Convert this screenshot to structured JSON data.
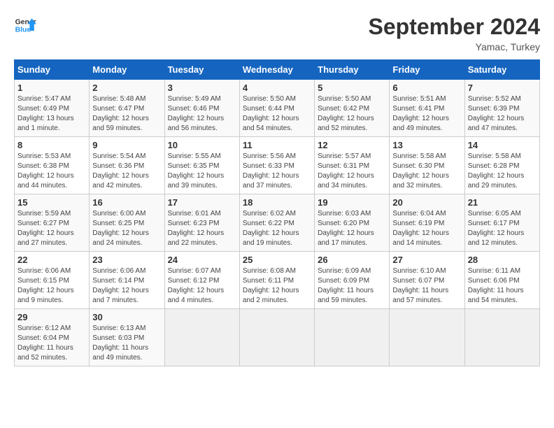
{
  "header": {
    "logo_line1": "General",
    "logo_line2": "Blue",
    "month": "September 2024",
    "location": "Yamac, Turkey"
  },
  "days_of_week": [
    "Sunday",
    "Monday",
    "Tuesday",
    "Wednesday",
    "Thursday",
    "Friday",
    "Saturday"
  ],
  "weeks": [
    [
      {
        "day": "1",
        "info": "Sunrise: 5:47 AM\nSunset: 6:49 PM\nDaylight: 13 hours\nand 1 minute."
      },
      {
        "day": "2",
        "info": "Sunrise: 5:48 AM\nSunset: 6:47 PM\nDaylight: 12 hours\nand 59 minutes."
      },
      {
        "day": "3",
        "info": "Sunrise: 5:49 AM\nSunset: 6:46 PM\nDaylight: 12 hours\nand 56 minutes."
      },
      {
        "day": "4",
        "info": "Sunrise: 5:50 AM\nSunset: 6:44 PM\nDaylight: 12 hours\nand 54 minutes."
      },
      {
        "day": "5",
        "info": "Sunrise: 5:50 AM\nSunset: 6:42 PM\nDaylight: 12 hours\nand 52 minutes."
      },
      {
        "day": "6",
        "info": "Sunrise: 5:51 AM\nSunset: 6:41 PM\nDaylight: 12 hours\nand 49 minutes."
      },
      {
        "day": "7",
        "info": "Sunrise: 5:52 AM\nSunset: 6:39 PM\nDaylight: 12 hours\nand 47 minutes."
      }
    ],
    [
      {
        "day": "8",
        "info": "Sunrise: 5:53 AM\nSunset: 6:38 PM\nDaylight: 12 hours\nand 44 minutes."
      },
      {
        "day": "9",
        "info": "Sunrise: 5:54 AM\nSunset: 6:36 PM\nDaylight: 12 hours\nand 42 minutes."
      },
      {
        "day": "10",
        "info": "Sunrise: 5:55 AM\nSunset: 6:35 PM\nDaylight: 12 hours\nand 39 minutes."
      },
      {
        "day": "11",
        "info": "Sunrise: 5:56 AM\nSunset: 6:33 PM\nDaylight: 12 hours\nand 37 minutes."
      },
      {
        "day": "12",
        "info": "Sunrise: 5:57 AM\nSunset: 6:31 PM\nDaylight: 12 hours\nand 34 minutes."
      },
      {
        "day": "13",
        "info": "Sunrise: 5:58 AM\nSunset: 6:30 PM\nDaylight: 12 hours\nand 32 minutes."
      },
      {
        "day": "14",
        "info": "Sunrise: 5:58 AM\nSunset: 6:28 PM\nDaylight: 12 hours\nand 29 minutes."
      }
    ],
    [
      {
        "day": "15",
        "info": "Sunrise: 5:59 AM\nSunset: 6:27 PM\nDaylight: 12 hours\nand 27 minutes."
      },
      {
        "day": "16",
        "info": "Sunrise: 6:00 AM\nSunset: 6:25 PM\nDaylight: 12 hours\nand 24 minutes."
      },
      {
        "day": "17",
        "info": "Sunrise: 6:01 AM\nSunset: 6:23 PM\nDaylight: 12 hours\nand 22 minutes."
      },
      {
        "day": "18",
        "info": "Sunrise: 6:02 AM\nSunset: 6:22 PM\nDaylight: 12 hours\nand 19 minutes."
      },
      {
        "day": "19",
        "info": "Sunrise: 6:03 AM\nSunset: 6:20 PM\nDaylight: 12 hours\nand 17 minutes."
      },
      {
        "day": "20",
        "info": "Sunrise: 6:04 AM\nSunset: 6:19 PM\nDaylight: 12 hours\nand 14 minutes."
      },
      {
        "day": "21",
        "info": "Sunrise: 6:05 AM\nSunset: 6:17 PM\nDaylight: 12 hours\nand 12 minutes."
      }
    ],
    [
      {
        "day": "22",
        "info": "Sunrise: 6:06 AM\nSunset: 6:15 PM\nDaylight: 12 hours\nand 9 minutes."
      },
      {
        "day": "23",
        "info": "Sunrise: 6:06 AM\nSunset: 6:14 PM\nDaylight: 12 hours\nand 7 minutes."
      },
      {
        "day": "24",
        "info": "Sunrise: 6:07 AM\nSunset: 6:12 PM\nDaylight: 12 hours\nand 4 minutes."
      },
      {
        "day": "25",
        "info": "Sunrise: 6:08 AM\nSunset: 6:11 PM\nDaylight: 12 hours\nand 2 minutes."
      },
      {
        "day": "26",
        "info": "Sunrise: 6:09 AM\nSunset: 6:09 PM\nDaylight: 11 hours\nand 59 minutes."
      },
      {
        "day": "27",
        "info": "Sunrise: 6:10 AM\nSunset: 6:07 PM\nDaylight: 11 hours\nand 57 minutes."
      },
      {
        "day": "28",
        "info": "Sunrise: 6:11 AM\nSunset: 6:06 PM\nDaylight: 11 hours\nand 54 minutes."
      }
    ],
    [
      {
        "day": "29",
        "info": "Sunrise: 6:12 AM\nSunset: 6:04 PM\nDaylight: 11 hours\nand 52 minutes."
      },
      {
        "day": "30",
        "info": "Sunrise: 6:13 AM\nSunset: 6:03 PM\nDaylight: 11 hours\nand 49 minutes."
      },
      {
        "day": "",
        "info": ""
      },
      {
        "day": "",
        "info": ""
      },
      {
        "day": "",
        "info": ""
      },
      {
        "day": "",
        "info": ""
      },
      {
        "day": "",
        "info": ""
      }
    ]
  ]
}
